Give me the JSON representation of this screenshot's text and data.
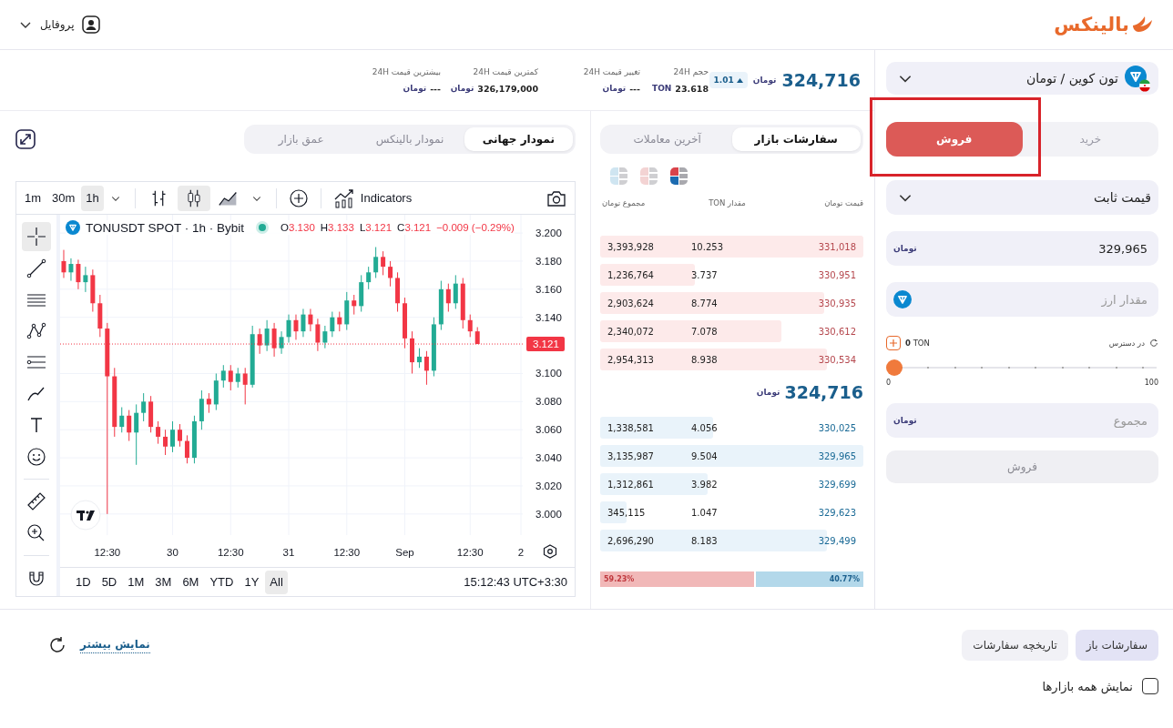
{
  "header": {
    "logo": "بالینکس",
    "profile": "پروفایل"
  },
  "ticker": {
    "price": "324,716",
    "currency": "تومان",
    "change_badge": "1.01",
    "stats": [
      {
        "label": "حجم 24H",
        "value": "23.618",
        "unit": "TON"
      },
      {
        "label": "تغییر قیمت 24H",
        "value": "---",
        "unit": "تومان"
      },
      {
        "label": "کمترین قیمت 24H",
        "value": "326,179,000",
        "unit": "تومان"
      },
      {
        "label": "بیشترین قیمت 24H",
        "value": "---",
        "unit": "تومان"
      }
    ]
  },
  "chart_panel": {
    "tabs": [
      {
        "label": "نمودار جهانی",
        "selected": true
      },
      {
        "label": "نمودار بالینکس",
        "selected": false
      },
      {
        "label": "عمق بازار",
        "selected": false
      }
    ],
    "intervals": [
      {
        "label": "1h",
        "selected": true
      },
      {
        "label": "30m",
        "selected": false
      },
      {
        "label": "1m",
        "selected": false
      }
    ],
    "chart_styles": [
      {
        "kind": "bars",
        "selected": false
      },
      {
        "kind": "candles",
        "selected": true
      },
      {
        "kind": "area",
        "selected": false
      }
    ],
    "indicators": "Indicators",
    "tool_groups": [
      {
        "tools": [
          {
            "kind": "crosshair",
            "selected": true
          },
          {
            "kind": "trend-line",
            "selected": false
          },
          {
            "kind": "horizontal-lines",
            "selected": false
          },
          {
            "kind": "path",
            "selected": false
          },
          {
            "kind": "fib",
            "selected": false
          },
          {
            "kind": "brush",
            "selected": false
          },
          {
            "kind": "text",
            "selected": false
          },
          {
            "kind": "emoji",
            "selected": false
          }
        ]
      },
      {
        "tools": [
          {
            "kind": "ruler",
            "selected": false
          },
          {
            "kind": "zoom",
            "selected": false
          }
        ]
      },
      {
        "tools": [
          {
            "kind": "magnet",
            "selected": false
          }
        ]
      }
    ],
    "legend": {
      "symbol": "TONUSDT SPOT · 1h · Bybit",
      "ohlc": [
        "C3.121",
        "L3.121",
        "H3.133",
        "O3.130"
      ],
      "change": "−0.009 (−0.29%)"
    },
    "chart_data": {
      "type": "candlestick",
      "categories": [
        null,
        null,
        null,
        null,
        null,
        null,
        "12:30",
        null,
        null,
        null,
        null,
        null,
        null,
        null,
        null,
        "30",
        null,
        null,
        null,
        null,
        null,
        null,
        null,
        "12:30",
        null,
        null,
        null,
        null,
        null,
        null,
        null,
        "31",
        null,
        null,
        null,
        null,
        null,
        null,
        null,
        "12:30",
        null,
        null,
        null,
        null,
        null,
        null,
        null,
        "Sep",
        null,
        null,
        null,
        null,
        null,
        null,
        null,
        null,
        "12:30",
        null,
        null,
        null,
        null,
        null,
        null,
        "2"
      ],
      "ohlc": [
        [
          3.18,
          3.188,
          3.168,
          3.172
        ],
        [
          3.172,
          3.182,
          3.166,
          3.178
        ],
        [
          3.178,
          3.181,
          3.16,
          3.165
        ],
        [
          3.165,
          3.176,
          3.158,
          3.17
        ],
        [
          3.17,
          3.174,
          3.144,
          3.15
        ],
        [
          3.15,
          3.156,
          3.126,
          3.132
        ],
        [
          3.132,
          3.136,
          3.0,
          3.098
        ],
        [
          3.098,
          3.104,
          3.055,
          3.062
        ],
        [
          3.062,
          3.076,
          3.058,
          3.07
        ],
        [
          3.07,
          3.074,
          3.052,
          3.058
        ],
        [
          3.058,
          3.078,
          3.035,
          3.072
        ],
        [
          3.072,
          3.086,
          3.066,
          3.08
        ],
        [
          3.08,
          3.084,
          3.058,
          3.062
        ],
        [
          3.062,
          3.066,
          3.05,
          3.055
        ],
        [
          3.055,
          3.06,
          3.042,
          3.048
        ],
        [
          3.048,
          3.066,
          3.044,
          3.06
        ],
        [
          3.06,
          3.064,
          3.048,
          3.052
        ],
        [
          3.052,
          3.056,
          3.036,
          3.04
        ],
        [
          3.04,
          3.07,
          3.036,
          3.066
        ],
        [
          3.066,
          3.088,
          3.06,
          3.082
        ],
        [
          3.082,
          3.086,
          3.072,
          3.078
        ],
        [
          3.078,
          3.1,
          3.074,
          3.095
        ],
        [
          3.095,
          3.106,
          3.09,
          3.102
        ],
        [
          3.102,
          3.106,
          3.088,
          3.094
        ],
        [
          3.094,
          3.104,
          3.09,
          3.1
        ],
        [
          3.1,
          3.104,
          3.078,
          3.092
        ],
        [
          3.092,
          3.134,
          3.09,
          3.128
        ],
        [
          3.128,
          3.132,
          3.114,
          3.12
        ],
        [
          3.12,
          3.138,
          3.116,
          3.132
        ],
        [
          3.132,
          3.136,
          3.112,
          3.118
        ],
        [
          3.118,
          3.13,
          3.114,
          3.126
        ],
        [
          3.126,
          3.142,
          3.122,
          3.138
        ],
        [
          3.138,
          3.142,
          3.124,
          3.13
        ],
        [
          3.13,
          3.146,
          3.126,
          3.142
        ],
        [
          3.142,
          3.146,
          3.13,
          3.135
        ],
        [
          3.135,
          3.139,
          3.116,
          3.122
        ],
        [
          3.122,
          3.134,
          3.118,
          3.13
        ],
        [
          3.13,
          3.144,
          3.126,
          3.14
        ],
        [
          3.14,
          3.144,
          3.13,
          3.135
        ],
        [
          3.135,
          3.158,
          3.131,
          3.152
        ],
        [
          3.152,
          3.156,
          3.142,
          3.148
        ],
        [
          3.148,
          3.17,
          3.144,
          3.165
        ],
        [
          3.165,
          3.176,
          3.16,
          3.172
        ],
        [
          3.172,
          3.19,
          3.168,
          3.183
        ],
        [
          3.183,
          3.187,
          3.17,
          3.176
        ],
        [
          3.176,
          3.18,
          3.162,
          3.168
        ],
        [
          3.168,
          3.172,
          3.144,
          3.15
        ],
        [
          3.15,
          3.154,
          3.118,
          3.125
        ],
        [
          3.125,
          3.13,
          3.1,
          3.108
        ],
        [
          3.108,
          3.118,
          3.104,
          3.112
        ],
        [
          3.112,
          3.116,
          3.092,
          3.102
        ],
        [
          3.102,
          3.14,
          3.098,
          3.135
        ],
        [
          3.135,
          3.166,
          3.131,
          3.16
        ],
        [
          3.16,
          3.164,
          3.144,
          3.15
        ],
        [
          3.15,
          3.17,
          3.146,
          3.164
        ],
        [
          3.164,
          3.168,
          3.132,
          3.138
        ],
        [
          3.138,
          3.142,
          3.126,
          3.13
        ],
        [
          3.13,
          3.133,
          3.121,
          3.121
        ],
        null,
        null,
        null,
        null,
        null,
        null
      ],
      "ylim": [
        2.985,
        3.213
      ],
      "grid": true,
      "ref_lines": [
        {
          "axis": "y",
          "value": 3.121,
          "label": "3.121",
          "color": "#f23645"
        }
      ],
      "yticks": [
        {
          "value": 3.2,
          "label": "3.200"
        },
        {
          "value": 3.18,
          "label": "3.180"
        },
        {
          "value": 3.16,
          "label": "3.160"
        },
        {
          "value": 3.14,
          "label": "3.140"
        },
        {
          "value": 3.1,
          "label": "3.100"
        },
        {
          "value": 3.08,
          "label": "3.080"
        },
        {
          "value": 3.06,
          "label": "3.060"
        },
        {
          "value": 3.04,
          "label": "3.040"
        },
        {
          "value": 3.02,
          "label": "3.020"
        },
        {
          "value": 3.0,
          "label": "3.000"
        }
      ]
    },
    "ranges": [
      {
        "label": "All",
        "selected": true
      },
      {
        "label": "1Y",
        "selected": false
      },
      {
        "label": "YTD",
        "selected": false
      },
      {
        "label": "6M",
        "selected": false
      },
      {
        "label": "3M",
        "selected": false
      },
      {
        "label": "1M",
        "selected": false
      },
      {
        "label": "5D",
        "selected": false
      },
      {
        "label": "1D",
        "selected": false
      }
    ],
    "clock": "15:12:43 UTC+3:30"
  },
  "order_book": {
    "tabs": [
      {
        "label": "سفارشات بازار",
        "selected": true
      },
      {
        "label": "آخرین معاملات",
        "selected": false
      }
    ],
    "views": [
      {
        "kind": "both",
        "selected": true
      },
      {
        "kind": "sells",
        "selected": false
      },
      {
        "kind": "buys",
        "selected": false
      }
    ],
    "columns": [
      "قیمت تومان",
      "مقدار TON",
      "مجموع تومان"
    ],
    "asks": [
      {
        "price": "331,018",
        "amount": "10.253",
        "total": "3,393,928"
      },
      {
        "price": "330,951",
        "amount": "3.737",
        "total": "1,236,764"
      },
      {
        "price": "330,935",
        "amount": "8.774",
        "total": "2,903,624"
      },
      {
        "price": "330,612",
        "amount": "7.078",
        "total": "2,340,072"
      },
      {
        "price": "330,534",
        "amount": "8.938",
        "total": "2,954,313"
      }
    ],
    "mid_price": "324,716",
    "mid_currency": "تومان",
    "bids": [
      {
        "price": "330,025",
        "amount": "4.056",
        "total": "1,338,581"
      },
      {
        "price": "329,965",
        "amount": "9.504",
        "total": "3,135,987"
      },
      {
        "price": "329,699",
        "amount": "3.982",
        "total": "1,312,861"
      },
      {
        "price": "329,623",
        "amount": "1.047",
        "total": "345,115"
      },
      {
        "price": "329,499",
        "amount": "8.183",
        "total": "2,696,290"
      }
    ],
    "sell_share": {
      "label": "59.23%",
      "level": 0.59
    },
    "buy_share_label": "40.77%"
  },
  "order_form": {
    "pair": "تون کوین / تومان",
    "sides": [
      {
        "label": "خرید",
        "kind": "buy",
        "selected": false
      },
      {
        "label": "فروش",
        "kind": "sell",
        "selected": true
      }
    ],
    "order_type": "قیمت ثابت",
    "price": {
      "value": "329,965",
      "unit": "تومان"
    },
    "amount": {
      "placeholder": "مقدار ارز"
    },
    "available": {
      "label": "در دسترس",
      "value": "0",
      "unit": "TON"
    },
    "slider": {
      "level": 0,
      "min": "0",
      "max": "100"
    },
    "total": {
      "placeholder": "مجموع",
      "unit": "تومان"
    },
    "submit": {
      "label": "فروش",
      "disabled": true
    }
  },
  "orders": {
    "tabs": [
      {
        "label": "سفارشات باز",
        "selected": true
      },
      {
        "label": "تاریخچه سفارشات",
        "selected": false
      }
    ],
    "show_more": "نمایش بیشتر",
    "all_markets": {
      "label": "نمایش همه بازارها",
      "checked": false
    }
  }
}
